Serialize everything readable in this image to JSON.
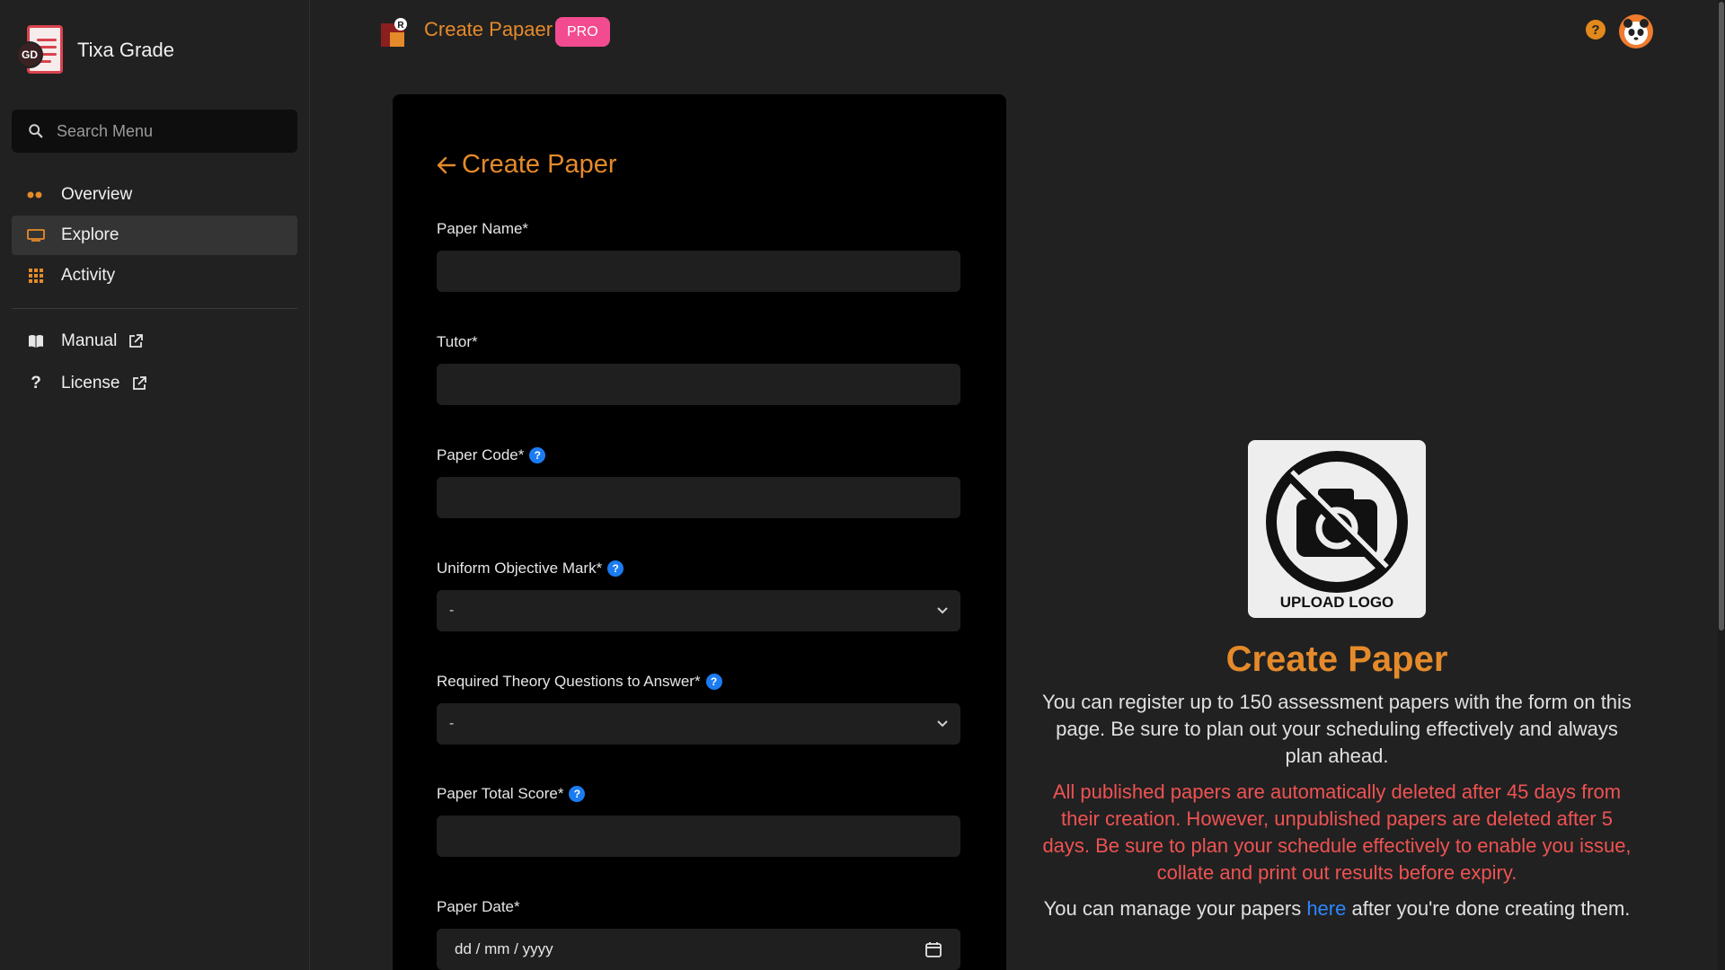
{
  "brand": {
    "name": "Tixa Grade",
    "badge": "GD"
  },
  "sidebar": {
    "search_placeholder": "Search Menu",
    "items": [
      {
        "label": "Overview",
        "icon": "dots-icon",
        "active": false
      },
      {
        "label": "Explore",
        "icon": "monitor-icon",
        "active": true
      },
      {
        "label": "Activity",
        "icon": "grid-icon",
        "active": false
      }
    ],
    "external": [
      {
        "label": "Manual",
        "icon": "book-icon"
      },
      {
        "label": "License",
        "icon": "question-icon"
      }
    ]
  },
  "topbar": {
    "title": "Create Papaer",
    "badge": "PRO",
    "help": "?"
  },
  "form": {
    "title": "Create Paper",
    "fields": {
      "paper_name": {
        "label": "Paper Name*",
        "value": ""
      },
      "tutor": {
        "label": "Tutor*",
        "value": ""
      },
      "paper_code": {
        "label": "Paper Code*",
        "value": ""
      },
      "objective_mark": {
        "label": "Uniform Objective Mark*",
        "value": "-"
      },
      "theory_questions": {
        "label": "Required Theory Questions to Answer*",
        "value": "-"
      },
      "total_score": {
        "label": "Paper Total Score*",
        "value": ""
      },
      "paper_date": {
        "label": "Paper Date*",
        "placeholder": "dd / mm / yyyy"
      }
    }
  },
  "info": {
    "logo_caption": "UPLOAD LOGO",
    "title": "Create Paper",
    "paragraph1": "You can register up to 150 assessment papers with the form on this page. Be sure to plan out your scheduling effectively and always plan ahead.",
    "paragraph2": "All published papers are automatically deleted after 45 days from their creation. However, unpublished papers are deleted after 5 days. Be sure to plan your schedule effectively to enable you issue, collate and print out results before expiry.",
    "paragraph3_before": "You can manage your papers ",
    "paragraph3_link": "here",
    "paragraph3_after": " after you're done creating them."
  },
  "colors": {
    "accent": "#e58a2a",
    "pro_badge": "#f24b8f",
    "warning_text": "#f05252",
    "link": "#2d86ff",
    "help_badge": "#1b7cf2"
  }
}
